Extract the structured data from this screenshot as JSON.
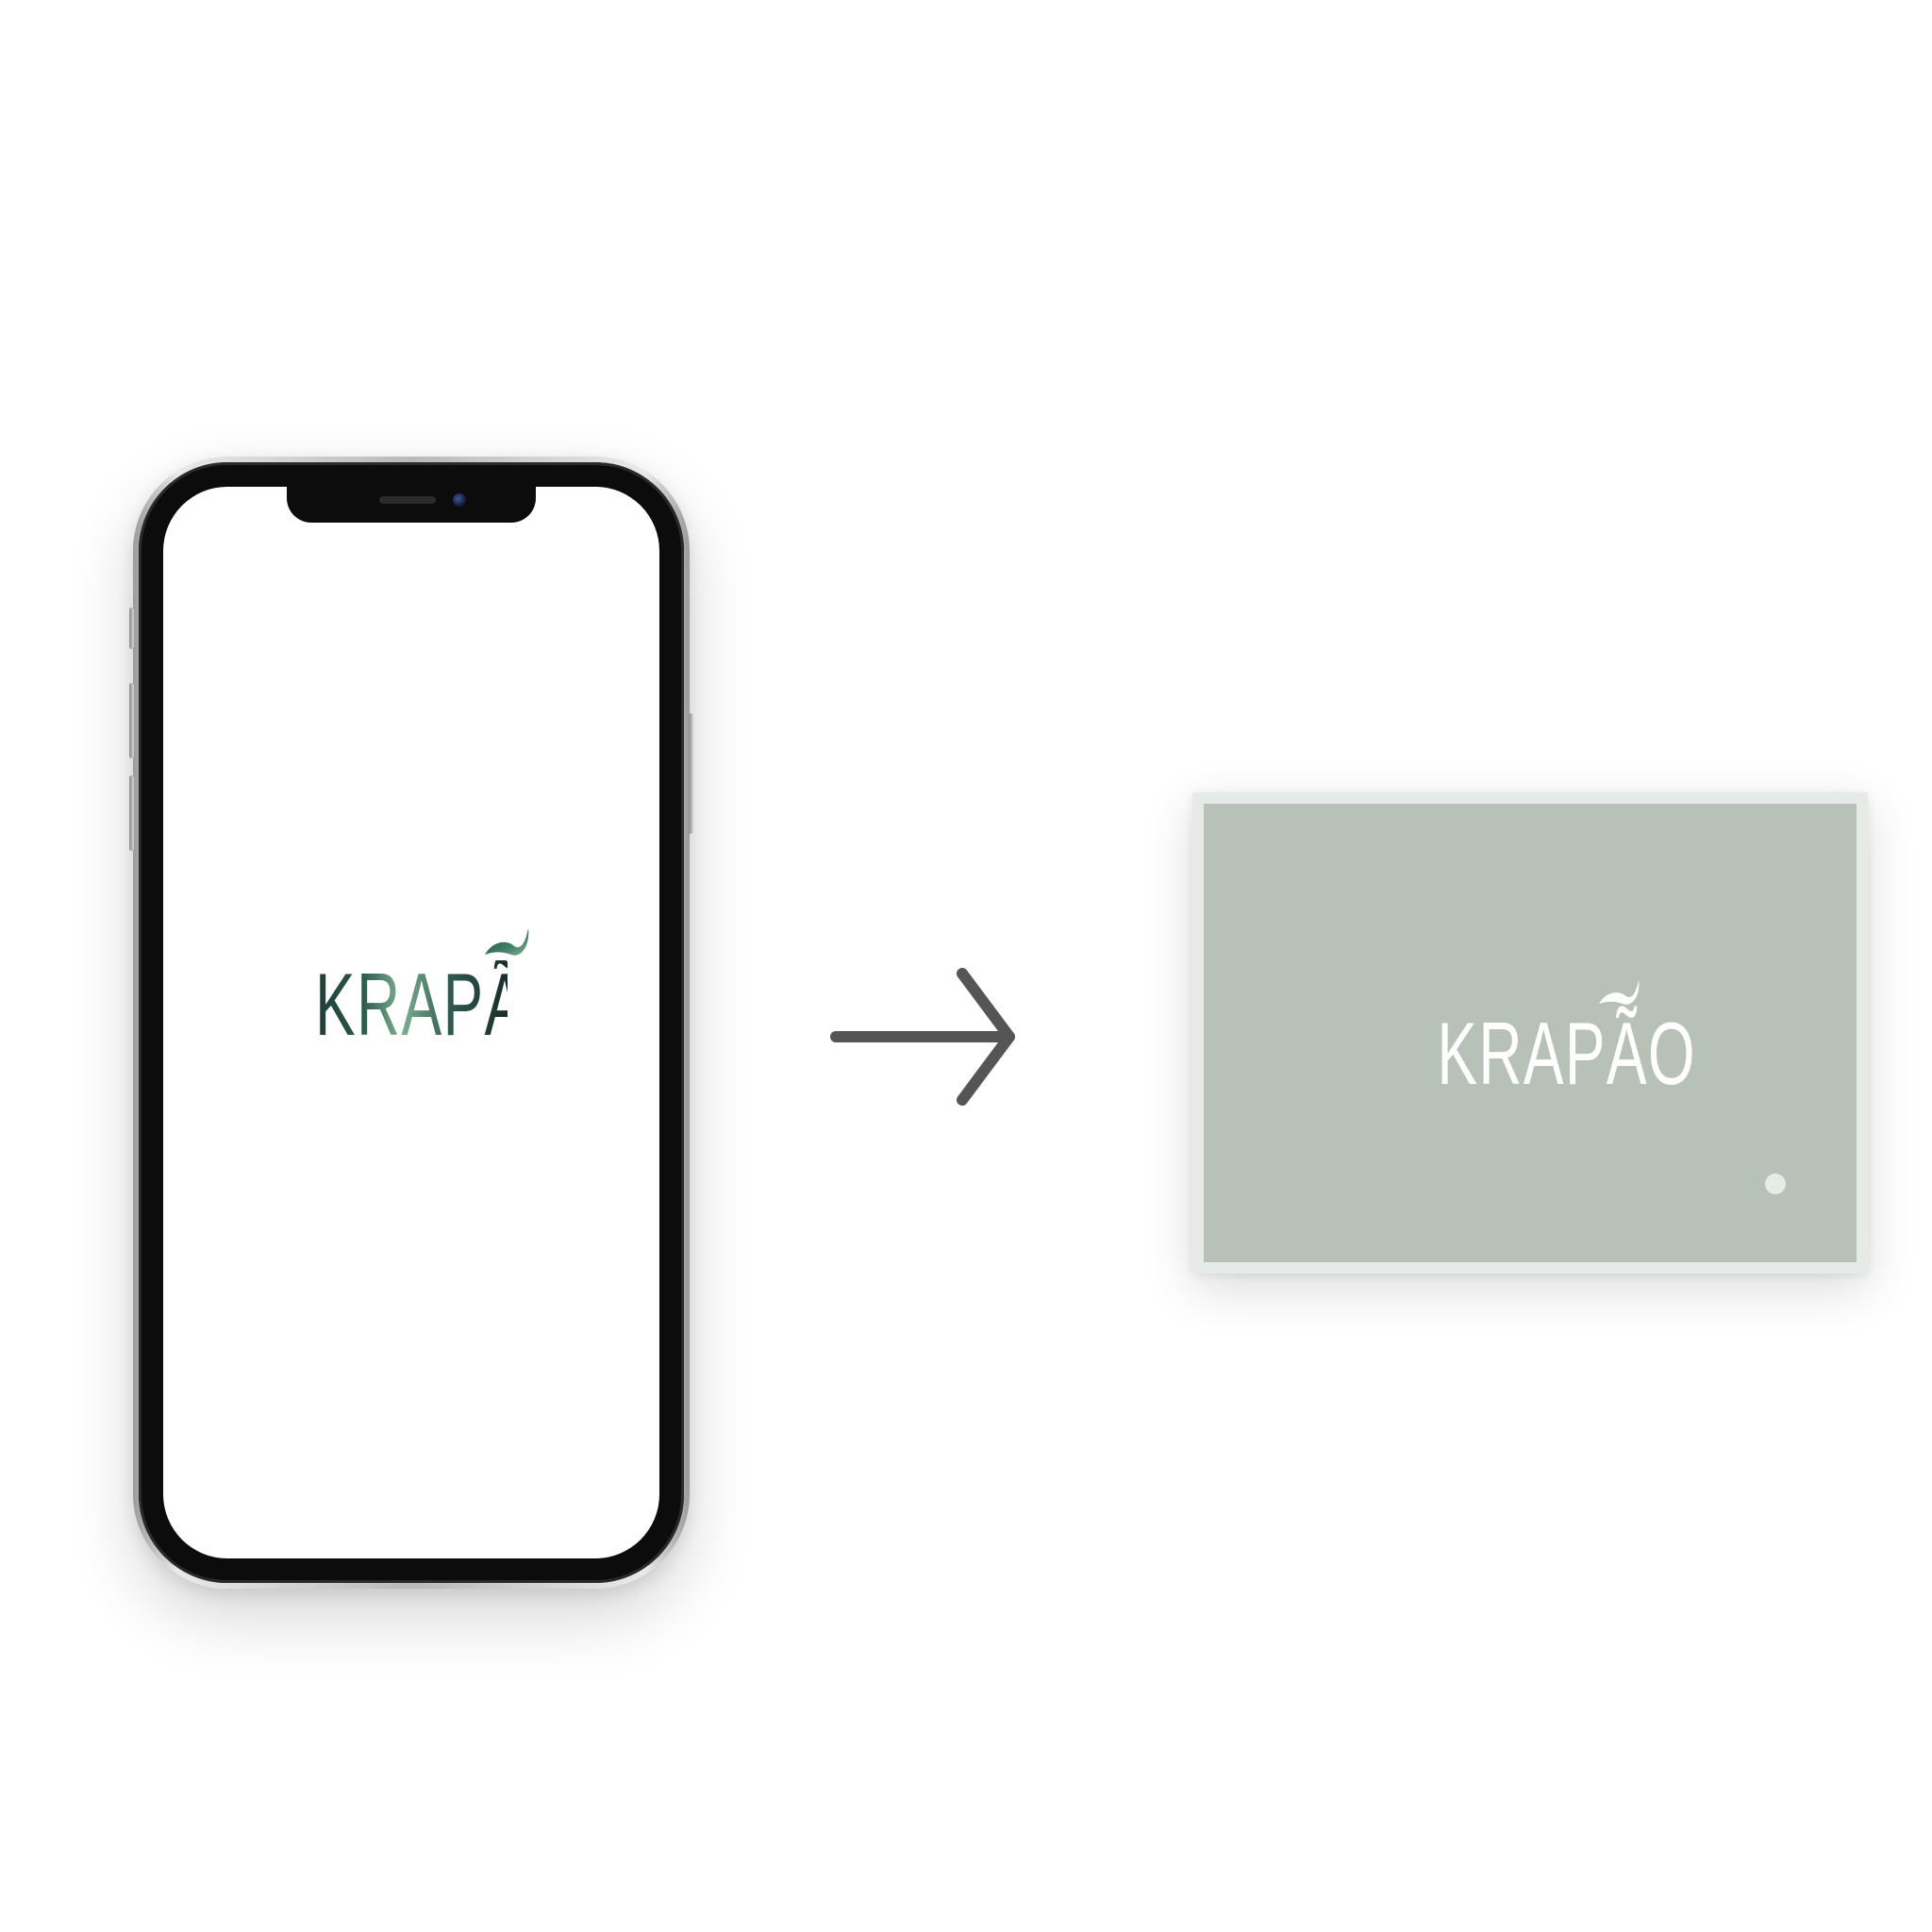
{
  "phone_screen": {
    "brand": "KRAPÃO",
    "background_color": "#ffffff",
    "logo_colors": [
      "#1f3d35",
      "#2d5a4e",
      "#7fb092",
      "#1a2d28"
    ]
  },
  "arrow": {
    "color": "#555555"
  },
  "card": {
    "brand": "KRAPÃO",
    "face_color": "#b8c1b8",
    "border_color": "#e7ebe7",
    "logo_color": "#ffffff"
  },
  "icons": [
    "phone-device",
    "arrow-right-icon",
    "leaf-tilde-icon",
    "card-dot"
  ]
}
